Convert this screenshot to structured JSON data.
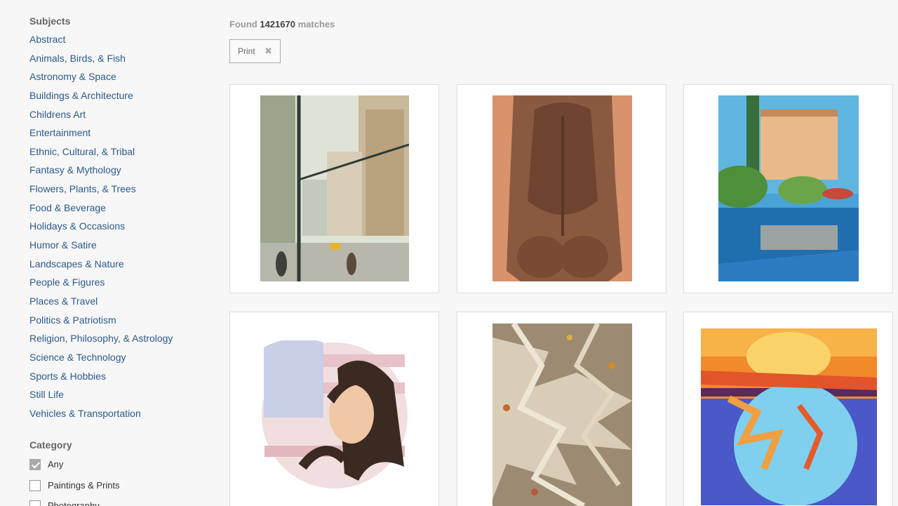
{
  "sidebar": {
    "subjects_title": "Subjects",
    "subjects": [
      "Abstract",
      "Animals, Birds, & Fish",
      "Astronomy & Space",
      "Buildings & Architecture",
      "Childrens Art",
      "Entertainment",
      "Ethnic, Cultural, & Tribal",
      "Fantasy & Mythology",
      "Flowers, Plants, & Trees",
      "Food & Beverage",
      "Holidays & Occasions",
      "Humor & Satire",
      "Landscapes & Nature",
      "People & Figures",
      "Places & Travel",
      "Politics & Patriotism",
      "Religion, Philosophy, & Astrology",
      "Science & Technology",
      "Sports & Hobbies",
      "Still Life",
      "Vehicles & Transportation"
    ],
    "category_title": "Category",
    "categories": [
      {
        "label": "Any",
        "checked": true
      },
      {
        "label": "Paintings & Prints",
        "checked": false
      },
      {
        "label": "Photography",
        "checked": false
      }
    ]
  },
  "results": {
    "found_prefix": "Found",
    "count": "1421670",
    "found_suffix": "matches"
  },
  "filter_chip": {
    "label": "Print",
    "remove_icon": "close-icon"
  },
  "colors": {
    "link": "#2b5a8a",
    "checked_box": "#a9a9a9"
  }
}
